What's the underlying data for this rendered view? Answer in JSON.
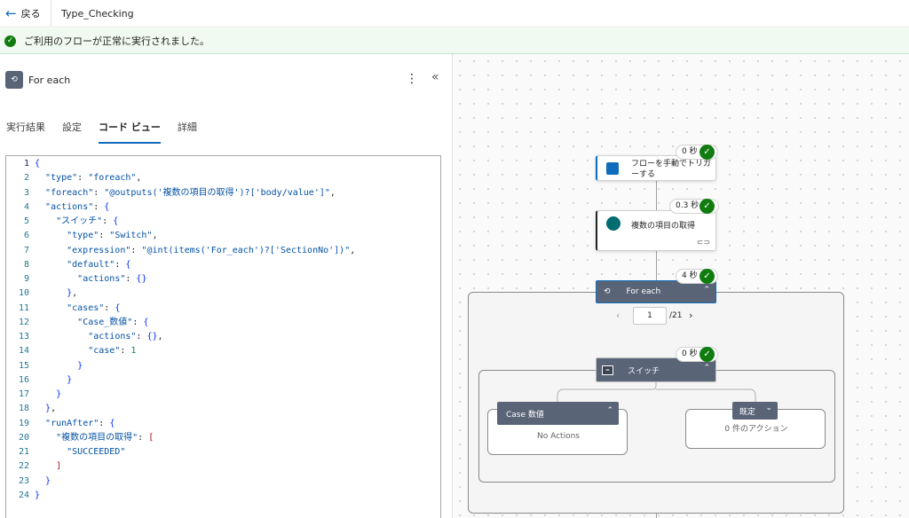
{
  "topbar": {
    "back_label": "戻る",
    "flow_name": "Type_Checking"
  },
  "banner": {
    "message": "ご利用のフローが正常に実行されました。"
  },
  "panel": {
    "title": "For each",
    "tabs": [
      "実行結果",
      "設定",
      "コード ビュー",
      "詳細"
    ],
    "active_tab": "コード ビュー"
  },
  "code_lines": [
    "{",
    "  \"type\": \"foreach\",",
    "  \"foreach\": \"@outputs('複数の項目の取得')?['body/value']\",",
    "  \"actions\": {",
    "    \"スイッチ\": {",
    "      \"type\": \"Switch\",",
    "      \"expression\": \"@int(items('For_each')?['SectionNo'])\",",
    "      \"default\": {",
    "        \"actions\": {}",
    "      },",
    "      \"cases\": {",
    "        \"Case_数値\": {",
    "          \"actions\": {},",
    "          \"case\": 1",
    "        }",
    "      }",
    "    }",
    "  },",
    "  \"runAfter\": {",
    "    \"複数の項目の取得\": [",
    "      \"SUCCEEDED\"",
    "    ]",
    "  }",
    "}"
  ],
  "flow": {
    "trigger": {
      "label": "フローを手動でトリガーする",
      "duration": "0 秒"
    },
    "get_items": {
      "label": "複数の項目の取得",
      "duration": "0.3 秒"
    },
    "foreach": {
      "label": "For each",
      "duration": "4 秒"
    },
    "pager": {
      "current": "1",
      "total": "/21"
    },
    "switch": {
      "label": "スイッチ",
      "duration": "0 秒"
    },
    "case": {
      "label": "Case 数値",
      "empty": "No Actions"
    },
    "default": {
      "label": "既定",
      "empty": "0 件のアクション"
    }
  }
}
